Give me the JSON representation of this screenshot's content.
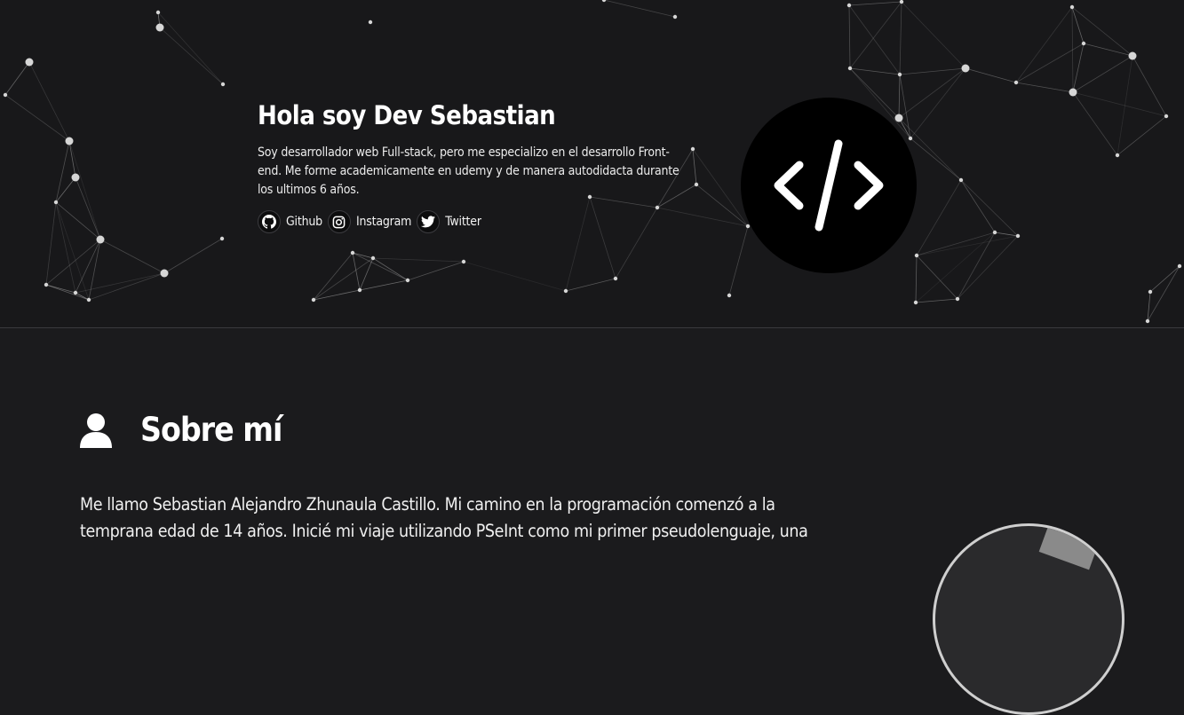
{
  "hero": {
    "title": "Hola soy Dev Sebastian",
    "description": "Soy desarrollador web Full-stack, pero me especializo en el desarrollo Front-end. Me forme academicamente en udemy y de manera autodidacta durante los ultimos 6 años.",
    "links": [
      {
        "label": "Github",
        "icon": "github-icon"
      },
      {
        "label": "Instagram",
        "icon": "instagram-icon"
      },
      {
        "label": "Twitter",
        "icon": "twitter-icon"
      }
    ],
    "logo_icon": "code-icon"
  },
  "about": {
    "title": "Sobre mí",
    "icon": "user-icon",
    "text": "Me llamo Sebastian Alejandro Zhunaula Castillo. Mi camino en la programación comenzó a la temprana edad de 14 años. Inicié mi viaje utilizando PSeInt como mi primer pseudolenguaje, una"
  },
  "colors": {
    "background": "#1b1b1d",
    "hero_background": "#18181a",
    "text": "#f2f2f2",
    "network": "#cfcfcf"
  }
}
